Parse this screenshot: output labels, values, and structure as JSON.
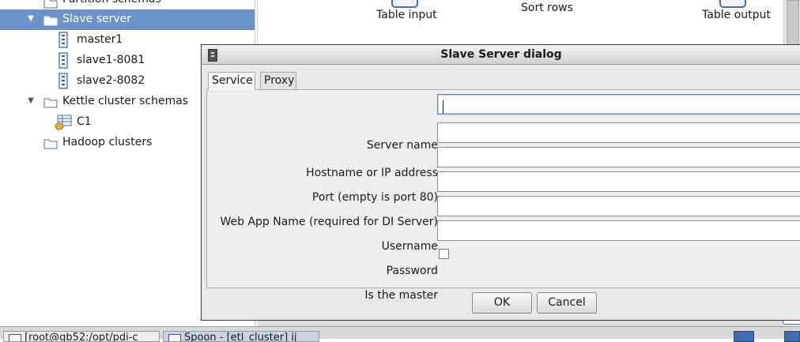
{
  "tree": {
    "cut_item": "Partition schemas",
    "slave_server": "Slave server",
    "servers": [
      "master1",
      "slave1-8081",
      "slave2-8082"
    ],
    "kettle_cluster": "Kettle cluster schemas",
    "cluster_item": "C1",
    "hadoop": "Hadoop clusters"
  },
  "canvas": {
    "steps": [
      "Table input",
      "Sort rows",
      "Table output"
    ]
  },
  "dialog": {
    "title": "Slave Server dialog",
    "tabs": [
      "Service",
      "Proxy"
    ],
    "fields": {
      "server_name": {
        "label": "Server name",
        "value": ""
      },
      "hostname": {
        "label": "Hostname or IP address",
        "value": ""
      },
      "port": {
        "label": "Port (empty is port 80)",
        "value": ""
      },
      "webapp": {
        "label": "Web App Name (required for DI Server)",
        "value": ""
      },
      "username": {
        "label": "Username",
        "value": ""
      },
      "password": {
        "label": "Password",
        "value": ""
      },
      "is_master": {
        "label": "Is the master",
        "checked": false
      }
    },
    "ok_label": "OK",
    "cancel_label": "Cancel"
  },
  "taskbar": {
    "items": [
      "[root@gb52:/opt/pdi-c",
      "Spoon - [etl_cluster] ij"
    ]
  },
  "colors": {
    "selection": "#6a94c9",
    "accent": "#4a6fa5"
  }
}
